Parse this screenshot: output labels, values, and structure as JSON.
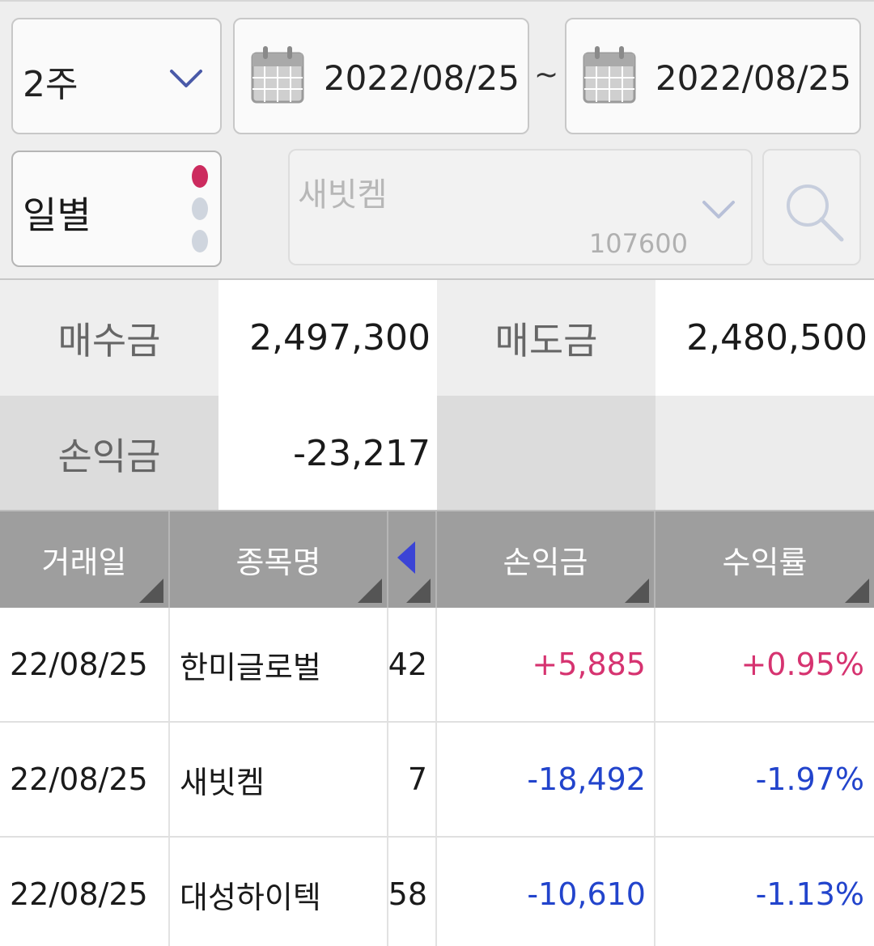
{
  "filters": {
    "period": {
      "value": "2주"
    },
    "date_start": "2022/08/25",
    "tilde": "~",
    "date_end": "2022/08/25",
    "mode": {
      "value": "일별"
    },
    "stock": {
      "name": "새빗켐",
      "code": "107600"
    }
  },
  "summary": {
    "buy_label": "매수금",
    "buy_value": "2,497,300",
    "sell_label": "매도금",
    "sell_value": "2,480,500",
    "pl_label": "손익금",
    "pl_value": "-23,217"
  },
  "table": {
    "headers": {
      "date": "거래일",
      "name": "종목명",
      "pl": "손익금",
      "rate": "수익률"
    },
    "rows": [
      {
        "date": "22/08/25",
        "name": "한미글로벌",
        "qty": "42",
        "pl": "+5,885",
        "rate": "+0.95%"
      },
      {
        "date": "22/08/25",
        "name": "새빗켐",
        "qty": "7",
        "pl": "-18,492",
        "rate": "-1.97%"
      },
      {
        "date": "22/08/25",
        "name": "대성하이텍",
        "qty": "58",
        "pl": "-10,610",
        "rate": "-1.13%"
      }
    ]
  },
  "colors": {
    "positive": "#d63370",
    "negative": "#2244cc",
    "header_bg": "#9e9e9e",
    "indicator_active": "#cc2b5e"
  },
  "icons": {
    "dropdown": "chevron-down-icon",
    "calendar": "calendar-icon",
    "search": "search-icon",
    "column_scroll": "arrow-left-icon"
  }
}
